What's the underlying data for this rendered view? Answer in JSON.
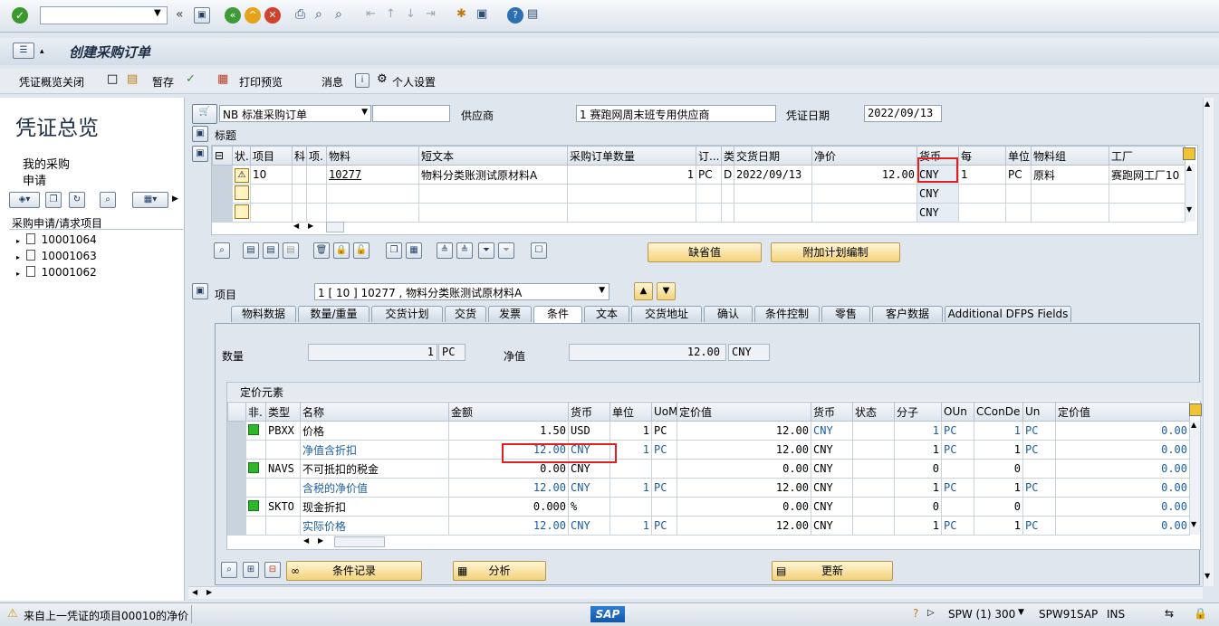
{
  "toolbar": {
    "command_value": ""
  },
  "title_bar": {
    "title": "创建采购订单"
  },
  "app_toolbar": {
    "items": [
      "凭证概览关闭",
      "暂存",
      "打印预览",
      "消息",
      "个人设置"
    ]
  },
  "sidebar": {
    "heading": "凭证总览",
    "my_purchase": "我的采购",
    "request": "申请",
    "tree_header": "采购申请/请求项目",
    "tree_items": [
      "10001064",
      "10001063",
      "10001062"
    ]
  },
  "header": {
    "doc_type": "NB 标准采购订单",
    "doc_number": "",
    "vendor_label": "供应商",
    "vendor_value": "1 赛跑网周末班专用供应商",
    "doc_date_label": "凭证日期",
    "doc_date_value": "2022/09/13",
    "title_toggle": "标题"
  },
  "items_table": {
    "columns": [
      "状.",
      "项目",
      "科",
      "项.",
      "物料",
      "短文本",
      "采购订单数量",
      "订...",
      "类",
      "交货日期",
      "净价",
      "货币",
      "每",
      "单位",
      "物料组",
      "工厂"
    ],
    "rows": [
      [
        "",
        "10",
        "",
        "",
        "10277",
        "物料分类账测试原材料A",
        "1",
        "PC",
        "D",
        "2022/09/13",
        "12.00",
        "CNY",
        "1",
        "PC",
        "原料",
        "赛跑网工厂10"
      ],
      [
        "",
        "",
        "",
        "",
        "",
        "",
        "",
        "",
        "",
        "",
        "",
        "CNY",
        "",
        "",
        "",
        ""
      ],
      [
        "",
        "",
        "",
        "",
        "",
        "",
        "",
        "",
        "",
        "",
        "",
        "CNY",
        "",
        "",
        "",
        ""
      ]
    ]
  },
  "item_buttons": {
    "default_values": "缺省值",
    "add_plan": "附加计划编制"
  },
  "item_detail": {
    "label": "项目",
    "selector": "1 [ 10 ] 10277 , 物料分类账测试原材料A",
    "tabs": [
      "物料数据",
      "数量/重量",
      "交货计划",
      "交货",
      "发票",
      "条件",
      "文本",
      "交货地址",
      "确认",
      "条件控制",
      "零售",
      "客户数据",
      "Additional DFPS Fields"
    ],
    "active_tab": "条件",
    "quantity_label": "数量",
    "quantity_value": "1",
    "quantity_unit": "PC",
    "net_label": "净值",
    "net_value": "12.00",
    "net_currency": "CNY"
  },
  "pricing": {
    "title": "定价元素",
    "columns": [
      "非.",
      "类型",
      "名称",
      "金额",
      "货币",
      "单位",
      "UoM",
      "定价值",
      "货币",
      "状态",
      "分子",
      "OUn",
      "CConDe",
      "Un",
      "定价值"
    ],
    "rows": [
      [
        "",
        "PBXX",
        "价格",
        "1.50",
        "USD",
        "1",
        "PC",
        "12.00",
        "CNY",
        "",
        "1",
        "PC",
        "1",
        "PC",
        "0.00"
      ],
      [
        "",
        "",
        "净值含折扣",
        "12.00",
        "CNY",
        "1",
        "PC",
        "12.00",
        "CNY",
        "",
        "1",
        "PC",
        "1",
        "PC",
        "0.00"
      ],
      [
        "",
        "NAVS",
        "不可抵扣的税金",
        "0.00",
        "CNY",
        "",
        "",
        "0.00",
        "CNY",
        "",
        "0",
        "",
        "0",
        "",
        "0.00"
      ],
      [
        "",
        "",
        "含税的净价值",
        "12.00",
        "CNY",
        "1",
        "PC",
        "12.00",
        "CNY",
        "",
        "1",
        "PC",
        "1",
        "PC",
        "0.00"
      ],
      [
        "",
        "SKTO",
        "现金折扣",
        "0.000",
        "%",
        "",
        "",
        "0.00",
        "CNY",
        "",
        "0",
        "",
        "0",
        "",
        "0.00"
      ],
      [
        "",
        "",
        "实际价格",
        "12.00",
        "CNY",
        "1",
        "PC",
        "12.00",
        "CNY",
        "",
        "1",
        "PC",
        "1",
        "PC",
        "0.00"
      ]
    ],
    "buttons": {
      "condition_record": "条件记录",
      "analysis": "分析",
      "update": "更新"
    }
  },
  "status_bar": {
    "message": "来自上一凭证的项目00010的净价",
    "logo": "SAP",
    "system": "SPW (1) 300",
    "server": "SPW91SAP",
    "mode": "INS"
  }
}
